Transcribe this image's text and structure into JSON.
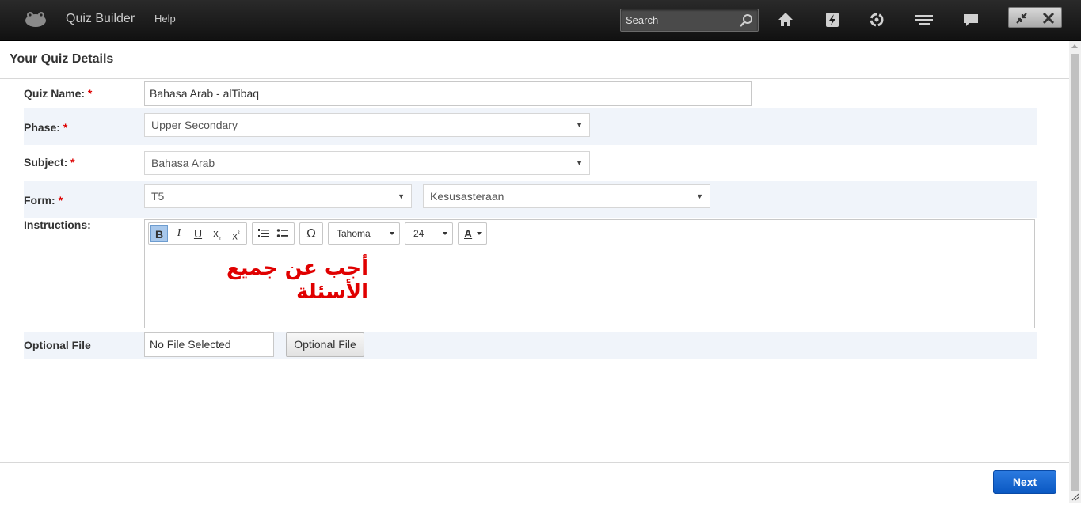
{
  "topbar": {
    "app_title": "Quiz Builder",
    "help_label": "Help",
    "search": {
      "placeholder": "Search",
      "value": ""
    },
    "nav_icons": [
      "home-icon",
      "lightning-icon",
      "recycle-icon",
      "layout-icon",
      "chat-icon"
    ],
    "window_buttons": [
      "collapse-icon",
      "close-icon"
    ]
  },
  "page": {
    "title": "Your Quiz Details"
  },
  "form": {
    "quiz_name": {
      "label": "Quiz Name:",
      "required": "*",
      "value": "Bahasa Arab - alTibaq"
    },
    "phase": {
      "label": "Phase:",
      "required": "*",
      "value": "Upper Secondary"
    },
    "subject": {
      "label": "Subject:",
      "required": "*",
      "value": "Bahasa Arab"
    },
    "form_field": {
      "label": "Form:",
      "required": "*",
      "value": "T5",
      "value2": "Kesusasteraan"
    },
    "instructions": {
      "label": "Instructions:",
      "font": "Tahoma",
      "size": "24",
      "content": "أجب عن جميع الأسئلة"
    },
    "optional_file": {
      "label": "Optional File",
      "value": "No File Selected",
      "button_label": "Optional File"
    }
  },
  "footer": {
    "next_label": "Next"
  },
  "colors": {
    "accent": "#0a58c2",
    "required": "#dd0000",
    "instruction_text": "#e00000"
  }
}
